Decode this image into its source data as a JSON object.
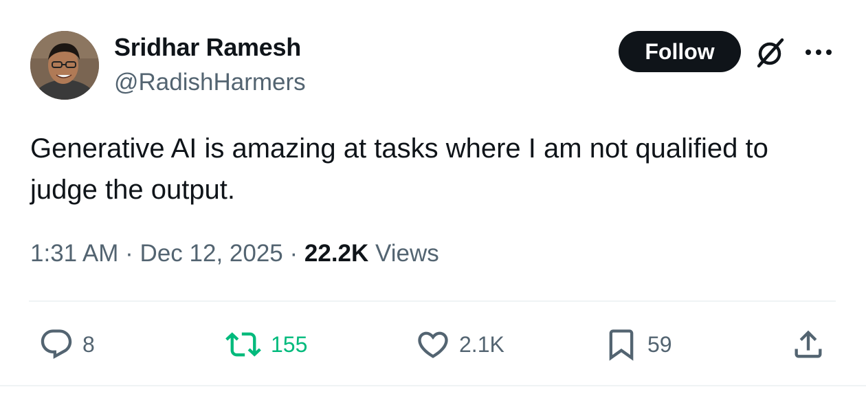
{
  "author": {
    "display_name": "Sridhar Ramesh",
    "handle": "@RadishHarmers",
    "avatar_icon": "profile-photo"
  },
  "header": {
    "follow_label": "Follow",
    "grok_icon": "grok-icon",
    "more_icon": "more-dots-icon"
  },
  "tweet": {
    "text": "Generative AI is amazing at tasks where I am not qualified to judge the output.",
    "time": "1:31 AM",
    "separator": "·",
    "date": "Dec 12, 2025",
    "views_count": "22.2K",
    "views_label": "Views"
  },
  "actions": {
    "replies": "8",
    "reposts": "155",
    "likes": "2.1K",
    "bookmarks": "59"
  },
  "colors": {
    "text_primary": "#0f1419",
    "text_secondary": "#536471",
    "retweet_green": "#00ba7c",
    "divider": "#eff3f4"
  }
}
